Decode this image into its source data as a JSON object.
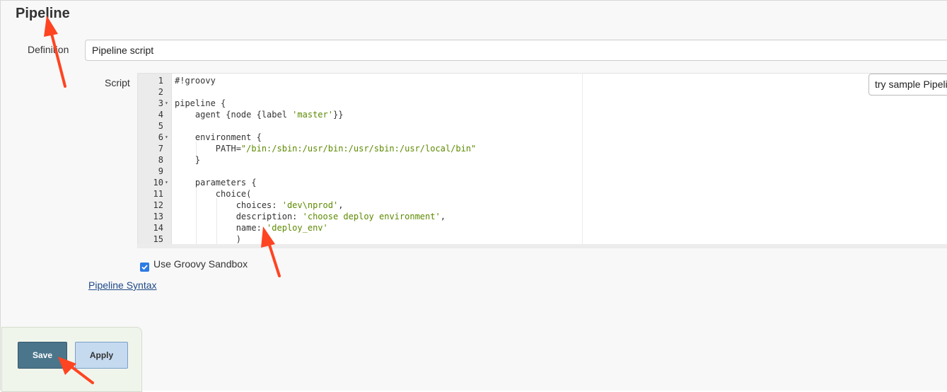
{
  "section": {
    "title": "Pipeline"
  },
  "definition": {
    "label": "Definition",
    "value": "Pipeline script"
  },
  "script": {
    "label": "Script",
    "sample_select": "try sample Pipeline...",
    "lines": [
      {
        "n": "1",
        "code": "#!groovy",
        "fold": ""
      },
      {
        "n": "2",
        "code": "",
        "fold": ""
      },
      {
        "n": "3",
        "code": "pipeline {",
        "fold": "▾"
      },
      {
        "n": "4",
        "code": "    agent {node {label ",
        "str": "'master'",
        "rest": "}}",
        "fold": ""
      },
      {
        "n": "5",
        "code": "",
        "fold": ""
      },
      {
        "n": "6",
        "code": "    environment {",
        "fold": "▾"
      },
      {
        "n": "7",
        "code": "        PATH=",
        "str": "\"/bin:/sbin:/usr/bin:/usr/sbin:/usr/local/bin\"",
        "rest": "",
        "fold": ""
      },
      {
        "n": "8",
        "code": "    }",
        "fold": ""
      },
      {
        "n": "9",
        "code": "",
        "fold": ""
      },
      {
        "n": "10",
        "code": "    parameters {",
        "fold": "▾"
      },
      {
        "n": "11",
        "code": "        choice(",
        "fold": ""
      },
      {
        "n": "12",
        "code": "            choices: ",
        "str": "'dev\\nprod'",
        "rest": ",",
        "fold": ""
      },
      {
        "n": "13",
        "code": "            description: ",
        "str": "'choose deploy environment'",
        "rest": ",",
        "fold": ""
      },
      {
        "n": "14",
        "code": "            name: ",
        "str": "'deploy_env'",
        "rest": "",
        "fold": ""
      },
      {
        "n": "15",
        "code": "            )",
        "fold": ""
      }
    ]
  },
  "sandbox": {
    "label": "Use Groovy Sandbox",
    "checked": true
  },
  "syntax_link": "Pipeline Syntax",
  "buttons": {
    "save": "Save",
    "apply": "Apply"
  },
  "colors": {
    "save_bg": "#4b758b",
    "apply_bg": "#c5d9ef",
    "arrow": "#ff4422",
    "string": "#5d8a00"
  }
}
